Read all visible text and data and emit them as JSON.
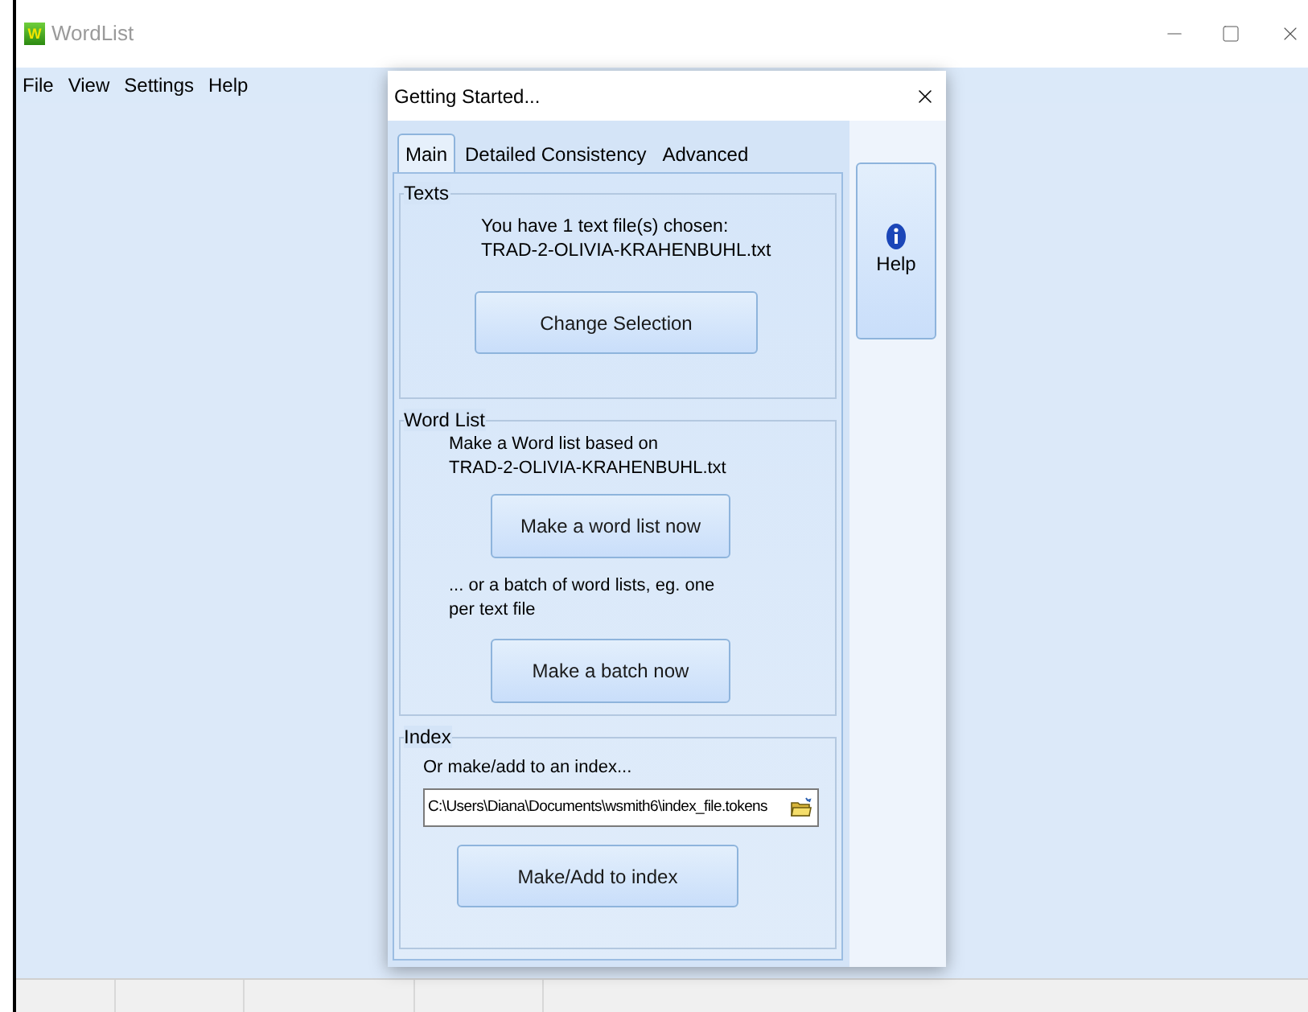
{
  "window": {
    "title": "WordList",
    "logo_letter": "W"
  },
  "menu": [
    {
      "label": "File"
    },
    {
      "label": "View"
    },
    {
      "label": "Settings"
    },
    {
      "label": "Help"
    }
  ],
  "dialog": {
    "title": "Getting Started...",
    "tabs": [
      {
        "label": "Main",
        "selected": true
      },
      {
        "label": "Detailed Consistency",
        "selected": false
      },
      {
        "label": "Advanced",
        "selected": false
      }
    ],
    "help_button": "Help",
    "texts": {
      "legend": "Texts",
      "line_1": "You have 1 text file(s) chosen:",
      "line_2": "TRAD-2-OLIVIA-KRAHENBUHL.txt",
      "button": "Change Selection"
    },
    "word_list": {
      "legend": "Word List",
      "line_1": "Make a Word list based on",
      "line_2": "TRAD-2-OLIVIA-KRAHENBUHL.txt",
      "button": "Make a word list now",
      "batch_text": "... or a batch of word lists, eg. one per text file",
      "batch_button": "Make a batch now"
    },
    "index": {
      "legend": "Index",
      "prompt": "Or make/add to an index...",
      "path": "C:\\Users\\Diana\\Documents\\wsmith6\\index_file.tokens",
      "button": "Make/Add to index"
    }
  }
}
